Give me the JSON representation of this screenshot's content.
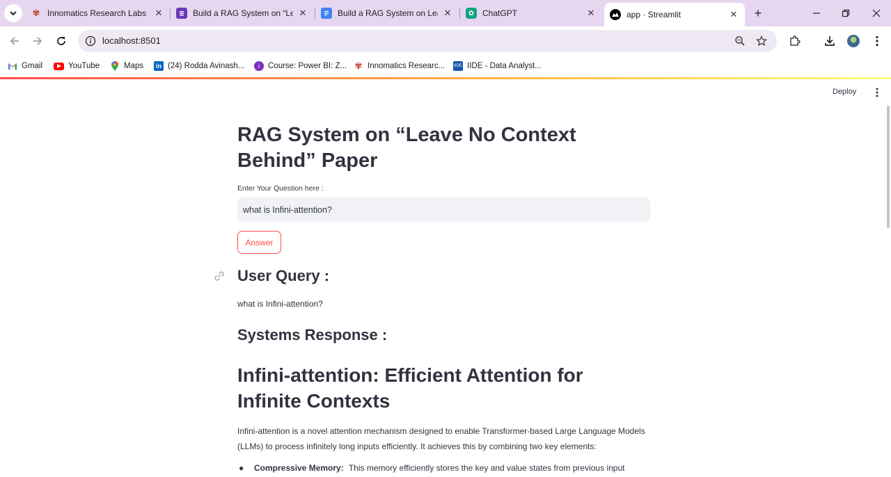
{
  "browser": {
    "tabs": [
      {
        "title": "Innomatics Research Labs",
        "icon": "innomatics-icon"
      },
      {
        "title": "Build a RAG System on “Lea",
        "icon": "forms-icon"
      },
      {
        "title": "Build a RAG System on Leav",
        "icon": "docs-icon"
      },
      {
        "title": "ChatGPT",
        "icon": "chatgpt-icon"
      },
      {
        "title": "app · Streamlit",
        "icon": "streamlit-icon"
      }
    ],
    "url": "localhost:8501",
    "bookmarks": [
      {
        "label": "Gmail",
        "icon": "gmail-icon"
      },
      {
        "label": "YouTube",
        "icon": "youtube-icon"
      },
      {
        "label": "Maps",
        "icon": "maps-icon"
      },
      {
        "label": "(24) Rodda Avinash...",
        "icon": "linkedin-icon"
      },
      {
        "label": "Course: Power BI: Z...",
        "icon": "course-icon"
      },
      {
        "label": "Innomatics Researc...",
        "icon": "innomatics-icon"
      },
      {
        "label": "IIDE - Data Analyst...",
        "icon": "iide-icon"
      }
    ]
  },
  "app": {
    "deploy_label": "Deploy",
    "title": "RAG System on “Leave No Context Behind” Paper",
    "input_label": "Enter Your Question here :",
    "input_value": "what is Infini-attention?",
    "answer_button": "Answer",
    "user_query_heading": "User Query :",
    "user_query_text": "what is Infini-attention?",
    "response_heading": "Systems Response :",
    "response_title": "Infini-attention: Efficient Attention for Infinite Contexts",
    "response_paragraph": "Infini-attention is a novel attention mechanism designed to enable Transformer-based Large Language Models (LLMs) to process infinitely long inputs efficiently. It achieves this by combining two key elements:",
    "bullet_term": "Compressive Memory:",
    "bullet_text": "This memory efficiently stores the key and value states from previous input"
  },
  "colors": {
    "accent": "#ff4b4b",
    "text": "#31333f",
    "tabbar": "#e6d6f0"
  }
}
